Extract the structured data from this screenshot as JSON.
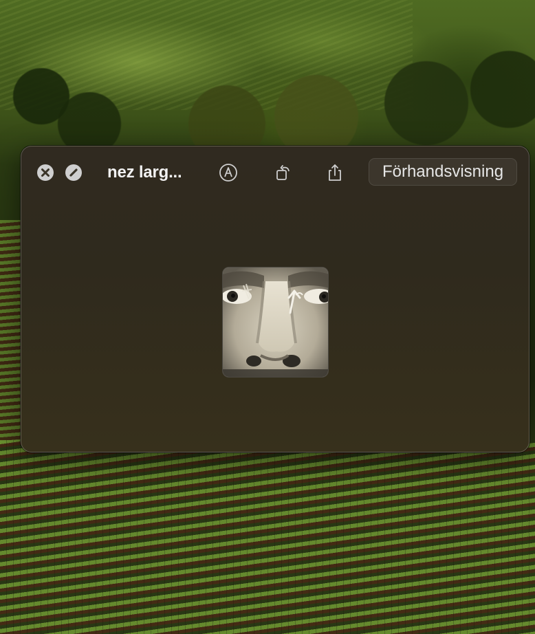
{
  "window": {
    "title": "nez larg...",
    "open_button_label": "Förhandsvisning"
  },
  "toolbar": {
    "close_icon": "close-icon",
    "hide_icon": "slash-icon",
    "markup_icon": "markup-pen-icon",
    "rotate_icon": "rotate-icon",
    "share_icon": "share-icon"
  },
  "preview": {
    "description_icon": "face-photo-thumbnail"
  },
  "colors": {
    "window_bg": "#302a20",
    "title_text": "#f2f2f2",
    "button_circle": "#cfcfcf"
  }
}
